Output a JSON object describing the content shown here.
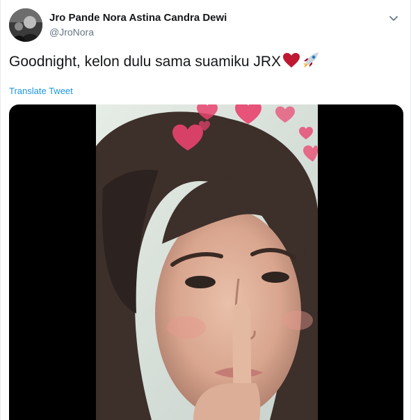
{
  "tweet": {
    "display_name": "Jro Pande Nora Astina Candra Dewi",
    "handle": "@JroNora",
    "text": "Goodnight, kelon dulu sama suamiku JRX",
    "emojis": [
      "red-heart",
      "rocket"
    ],
    "translate_label": "Translate Tweet"
  },
  "colors": {
    "text": "#14171a",
    "secondary": "#657786",
    "link": "#1b95e0",
    "border": "#e6ecf0",
    "media_background": "#000000"
  },
  "icons": {
    "caret": "chevron-down-icon",
    "heart": "red-heart-emoji",
    "rocket": "rocket-emoji"
  }
}
